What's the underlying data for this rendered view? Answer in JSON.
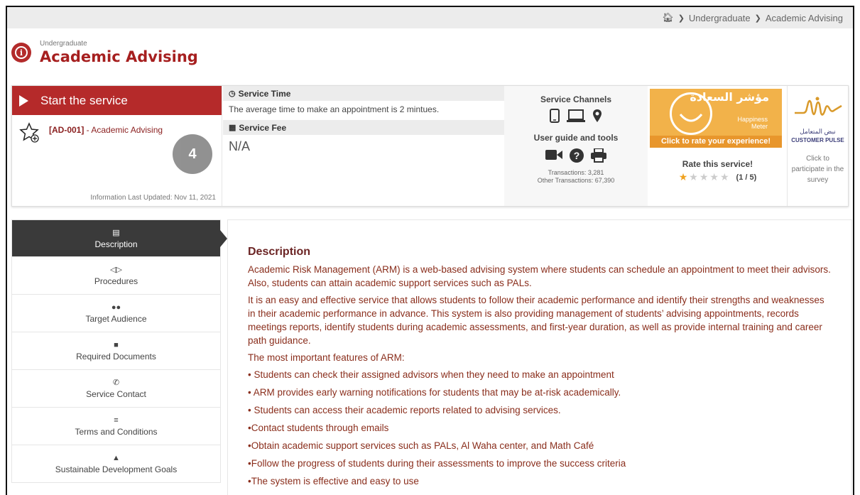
{
  "breadcrumb": {
    "items": [
      "Undergraduate",
      "Academic Advising"
    ]
  },
  "header": {
    "subtitle": "Undergraduate",
    "title": "Academic Advising"
  },
  "service": {
    "start_label": "Start the service",
    "code": "[AD-001]",
    "name": " - Academic Advising",
    "updated": "Information Last Updated: Nov 11, 2021",
    "badge": "4"
  },
  "time_fee": {
    "time_label": "Service Time",
    "time_text": "The average time to make an appointment is 2 mintues.",
    "fee_label": "Service Fee",
    "fee_value": "N/A"
  },
  "channels": {
    "label": "Service Channels",
    "guide_label": "User guide and tools",
    "transactions": "Transactions: 3,281",
    "other_transactions": "Other Transactions: 67,390"
  },
  "happiness": {
    "arabic_title": "مؤشر السعادة",
    "en_line1": "Happiness",
    "en_line2": "Meter",
    "cta": "Click to rate your experience!"
  },
  "rating": {
    "label": "Rate this service!",
    "score": "(1 / 5)",
    "value": 1,
    "max": 5
  },
  "pulse": {
    "arabic": "نبض المتعامل",
    "english": "CUSTOMER PULSE",
    "participate": "Click to participate in the survey"
  },
  "sidebar": {
    "items": [
      {
        "label": "Description",
        "icon": "file-icon"
      },
      {
        "label": "Procedures",
        "icon": "steps-icon"
      },
      {
        "label": "Target Audience",
        "icon": "users-icon"
      },
      {
        "label": "Required Documents",
        "icon": "folder-icon"
      },
      {
        "label": "Service Contact",
        "icon": "phone-icon"
      },
      {
        "label": "Terms and Conditions",
        "icon": "list-icon"
      },
      {
        "label": "Sustainable Development Goals",
        "icon": "trophy-icon"
      }
    ]
  },
  "content": {
    "heading": "Description",
    "p1": "Academic Risk Management (ARM) is a web-based advising system where students can schedule an appointment to meet their advisors. Also, students can attain academic support services such as PALs.",
    "p2": "It is an easy and effective service that allows students to follow their academic performance and identify their strengths and weaknesses in their academic performance in advance. This system is also providing management of students’ advising appointments, records meetings reports, identify students during academic assessments, and first-year duration, as well as provide internal training and career path guidance.",
    "p3": "The most important features of ARM:",
    "bullets": [
      "• Students can check their assigned advisors when they need to make an appointment",
      "• ARM provides early warning notifications for students that may be at-risk academically.",
      "• Students can access their academic reports related to advising services.",
      "•Contact students through emails",
      "•Obtain academic support services such as PALs, Al Waha center, and Math Café",
      "•Follow the progress of students during their assessments to improve the success criteria",
      "•The system is effective and easy to use"
    ]
  }
}
